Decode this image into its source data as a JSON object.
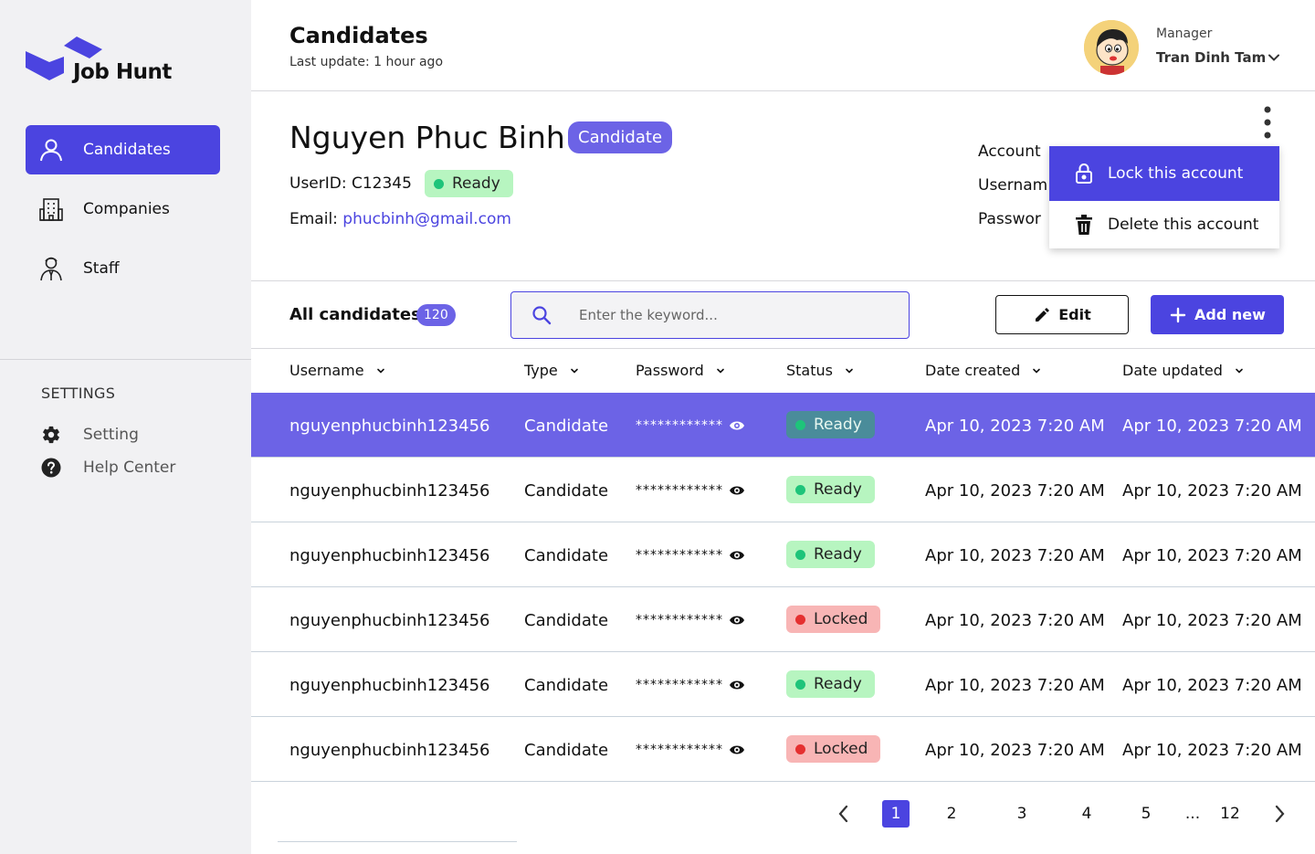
{
  "app": {
    "name": "Job Hunt"
  },
  "sidebar": {
    "items": [
      {
        "label": "Candidates",
        "icon": "user-icon",
        "active": true
      },
      {
        "label": "Companies",
        "icon": "building-icon",
        "active": false
      },
      {
        "label": "Staff",
        "icon": "staff-icon",
        "active": false
      }
    ],
    "settings_title": "SETTINGS",
    "settings_items": [
      {
        "label": "Setting",
        "icon": "gear-icon"
      },
      {
        "label": "Help Center",
        "icon": "help-icon"
      }
    ]
  },
  "header": {
    "title": "Candidates",
    "subtitle": "Last update: 1 hour ago",
    "user": {
      "role": "Manager",
      "name": "Tran Dinh Tam"
    }
  },
  "detail": {
    "name": "Nguyen Phuc Binh",
    "badge": "Candidate",
    "userid": "UserID: C12345",
    "status": "Ready",
    "email_label": "Email: ",
    "email": "phucbinh@gmail.com",
    "account_labels": [
      "Account",
      "Usernam",
      "Passwor"
    ],
    "menu": [
      {
        "label": "Lock this account",
        "icon": "lock-icon",
        "selected": true
      },
      {
        "label": "Delete this account",
        "icon": "trash-icon",
        "selected": false
      }
    ]
  },
  "toolbar": {
    "all_label": "All candidates",
    "count": "120",
    "search_placeholder": "Enter the keyword...",
    "edit_label": "Edit",
    "add_label": "Add new"
  },
  "table": {
    "columns": [
      "Username",
      "Type",
      "Password",
      "Status",
      "Date created",
      "Date updated"
    ],
    "rows": [
      {
        "username": "nguyenphucbinh123456",
        "type": "Candidate",
        "password": "************",
        "status": "Ready",
        "created": "Apr 10, 2023 7:20 AM",
        "updated": "Apr 10, 2023 7:20 AM",
        "selected": true
      },
      {
        "username": "nguyenphucbinh123456",
        "type": "Candidate",
        "password": "************",
        "status": "Ready",
        "created": "Apr 10, 2023 7:20 AM",
        "updated": "Apr 10, 2023 7:20 AM",
        "selected": false
      },
      {
        "username": "nguyenphucbinh123456",
        "type": "Candidate",
        "password": "************",
        "status": "Ready",
        "created": "Apr 10, 2023 7:20 AM",
        "updated": "Apr 10, 2023 7:20 AM",
        "selected": false
      },
      {
        "username": "nguyenphucbinh123456",
        "type": "Candidate",
        "password": "************",
        "status": "Locked",
        "created": "Apr 10, 2023 7:20 AM",
        "updated": "Apr 10, 2023 7:20 AM",
        "selected": false
      },
      {
        "username": "nguyenphucbinh123456",
        "type": "Candidate",
        "password": "************",
        "status": "Ready",
        "created": "Apr 10, 2023 7:20 AM",
        "updated": "Apr 10, 2023 7:20 AM",
        "selected": false
      },
      {
        "username": "nguyenphucbinh123456",
        "type": "Candidate",
        "password": "************",
        "status": "Locked",
        "created": "Apr 10, 2023 7:20 AM",
        "updated": "Apr 10, 2023 7:20 AM",
        "selected": false
      }
    ]
  },
  "pagination": {
    "pages": [
      "1",
      "2",
      "3",
      "4",
      "5",
      "...",
      "12"
    ],
    "current": "1"
  },
  "colors": {
    "accent": "#4b44e0",
    "accent_light": "#6c63e6",
    "ready_bg": "#b7f5c0",
    "ready_dot": "#1ec47a",
    "locked_bg": "#f8b5b5",
    "locked_dot": "#e53030"
  }
}
